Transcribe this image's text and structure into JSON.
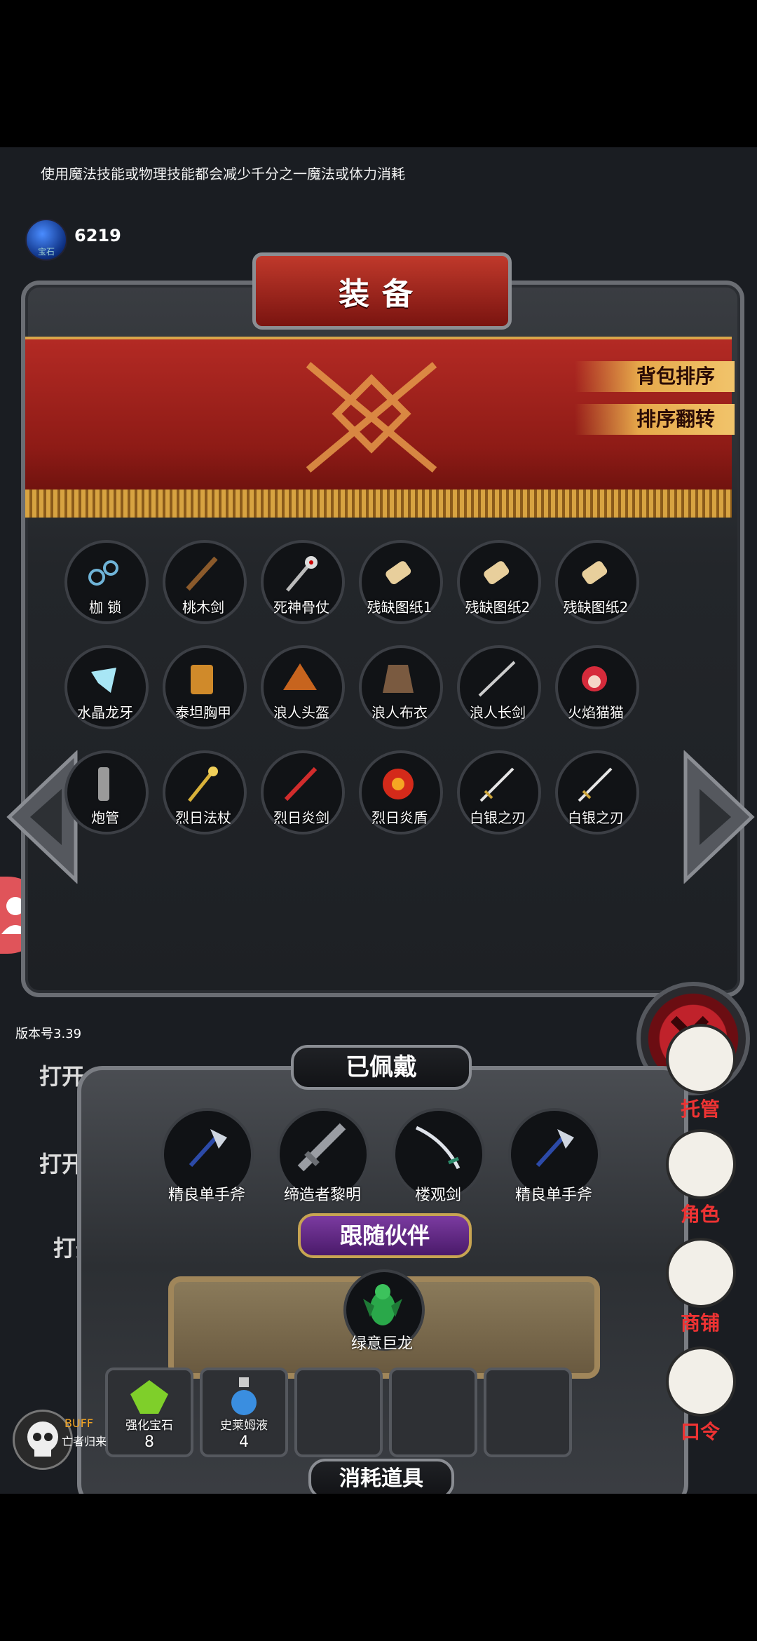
{
  "tip": "使用魔法技能或物理技能都会减少千分之一魔法或体力消耗",
  "currency": {
    "value": "6219",
    "label": "宝石",
    "icon": "blue-gem-icon"
  },
  "equip_panel": {
    "title": "装备",
    "sort_button": "背包排序",
    "reverse_button": "排序翻转"
  },
  "inventory": [
    {
      "label": "枷 锁",
      "icon": "shackles-icon"
    },
    {
      "label": "桃木剑",
      "icon": "wooden-sword-icon"
    },
    {
      "label": "死神骨仗",
      "icon": "bone-staff-icon"
    },
    {
      "label": "残缺图纸1",
      "icon": "scroll-icon"
    },
    {
      "label": "残缺图纸2",
      "icon": "scroll-icon"
    },
    {
      "label": "残缺图纸2",
      "icon": "scroll-icon"
    },
    {
      "label": "水晶龙牙",
      "icon": "crystal-fang-icon"
    },
    {
      "label": "泰坦胸甲",
      "icon": "chest-armor-icon"
    },
    {
      "label": "浪人头盔",
      "icon": "straw-hat-icon"
    },
    {
      "label": "浪人布衣",
      "icon": "cloth-robe-icon"
    },
    {
      "label": "浪人长剑",
      "icon": "katana-icon"
    },
    {
      "label": "火焰猫猫",
      "icon": "fire-cat-icon"
    },
    {
      "label": "炮管",
      "icon": "barrel-icon"
    },
    {
      "label": "烈日法杖",
      "icon": "sun-staff-icon"
    },
    {
      "label": "烈日炎剑",
      "icon": "flame-sword-icon"
    },
    {
      "label": "烈日炎盾",
      "icon": "sun-shield-icon"
    },
    {
      "label": "白银之刃",
      "icon": "silver-blade-icon"
    },
    {
      "label": "白银之刃",
      "icon": "silver-blade-icon"
    }
  ],
  "equipped_panel": {
    "title": "已佩戴",
    "items": [
      {
        "label": "精良单手斧",
        "icon": "axe-icon"
      },
      {
        "label": "缔造者黎明",
        "icon": "greatsword-icon"
      },
      {
        "label": "楼观剑",
        "icon": "curved-sword-icon"
      },
      {
        "label": "精良单手斧",
        "icon": "axe-icon"
      }
    ],
    "companion_title": "跟随伙伴",
    "companion": {
      "label": "绿意巨龙",
      "icon": "green-dragon-icon"
    },
    "consumables_title": "消耗道具",
    "consumables": [
      {
        "label": "强化宝石",
        "count": "8",
        "icon": "green-gem-icon"
      },
      {
        "label": "史莱姆液",
        "count": "4",
        "icon": "potion-icon"
      },
      {
        "label": "",
        "count": ""
      },
      {
        "label": "",
        "count": ""
      },
      {
        "label": "",
        "count": ""
      }
    ]
  },
  "version": "版本号3.39",
  "background_texts": [
    "打开",
    "打开",
    "打开"
  ],
  "side_menu": [
    {
      "label": "托管",
      "icon": "dice-icon"
    },
    {
      "label": "角色",
      "icon": "hooded-figure-icon"
    },
    {
      "label": "商铺",
      "icon": "shop-icon"
    },
    {
      "label": "口令",
      "icon": "book-icon"
    }
  ],
  "buff": {
    "title": "BUFF",
    "subtitle": "亡者归来",
    "icon": "skull-icon"
  },
  "colors": {
    "banner_red": "#9e1f1a",
    "gold": "#e6a84a",
    "label_red": "#ee3333"
  }
}
